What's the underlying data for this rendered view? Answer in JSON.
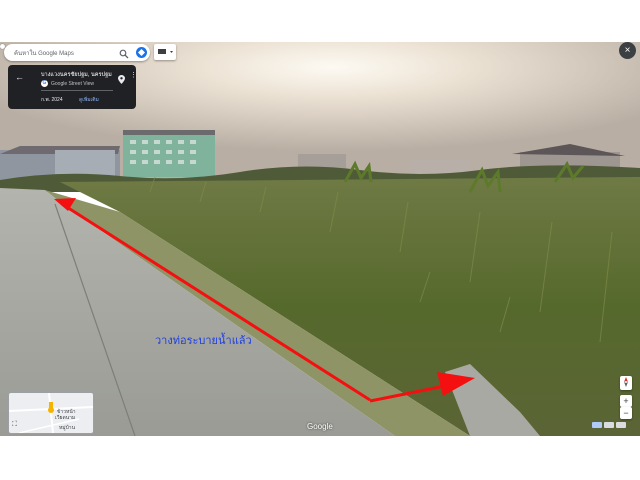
{
  "search": {
    "placeholder": "ค้นหาใน Google Maps"
  },
  "card": {
    "title": "บางแวงนครชัยปฐม, นครปฐม",
    "street_view_label": "Google Street View",
    "date": "ก.พ. 2024",
    "more_link": "ดูเพิ่มเติม"
  },
  "overlay": {
    "annotation_text": "วางท่อระบายน้ำแล้ว"
  },
  "minimap": {
    "labels": [
      "ข้าวหน้า",
      "เวียดนาม",
      "หมู่บ้าน"
    ]
  },
  "branding": {
    "google": "Google"
  },
  "controls": {
    "close": "×",
    "zoom_in": "+",
    "zoom_out": "−"
  },
  "colors": {
    "arrow": "#f41010",
    "annotation_text": "#1f3fe0",
    "card_bg": "#202124",
    "accent": "#1a73e8"
  }
}
